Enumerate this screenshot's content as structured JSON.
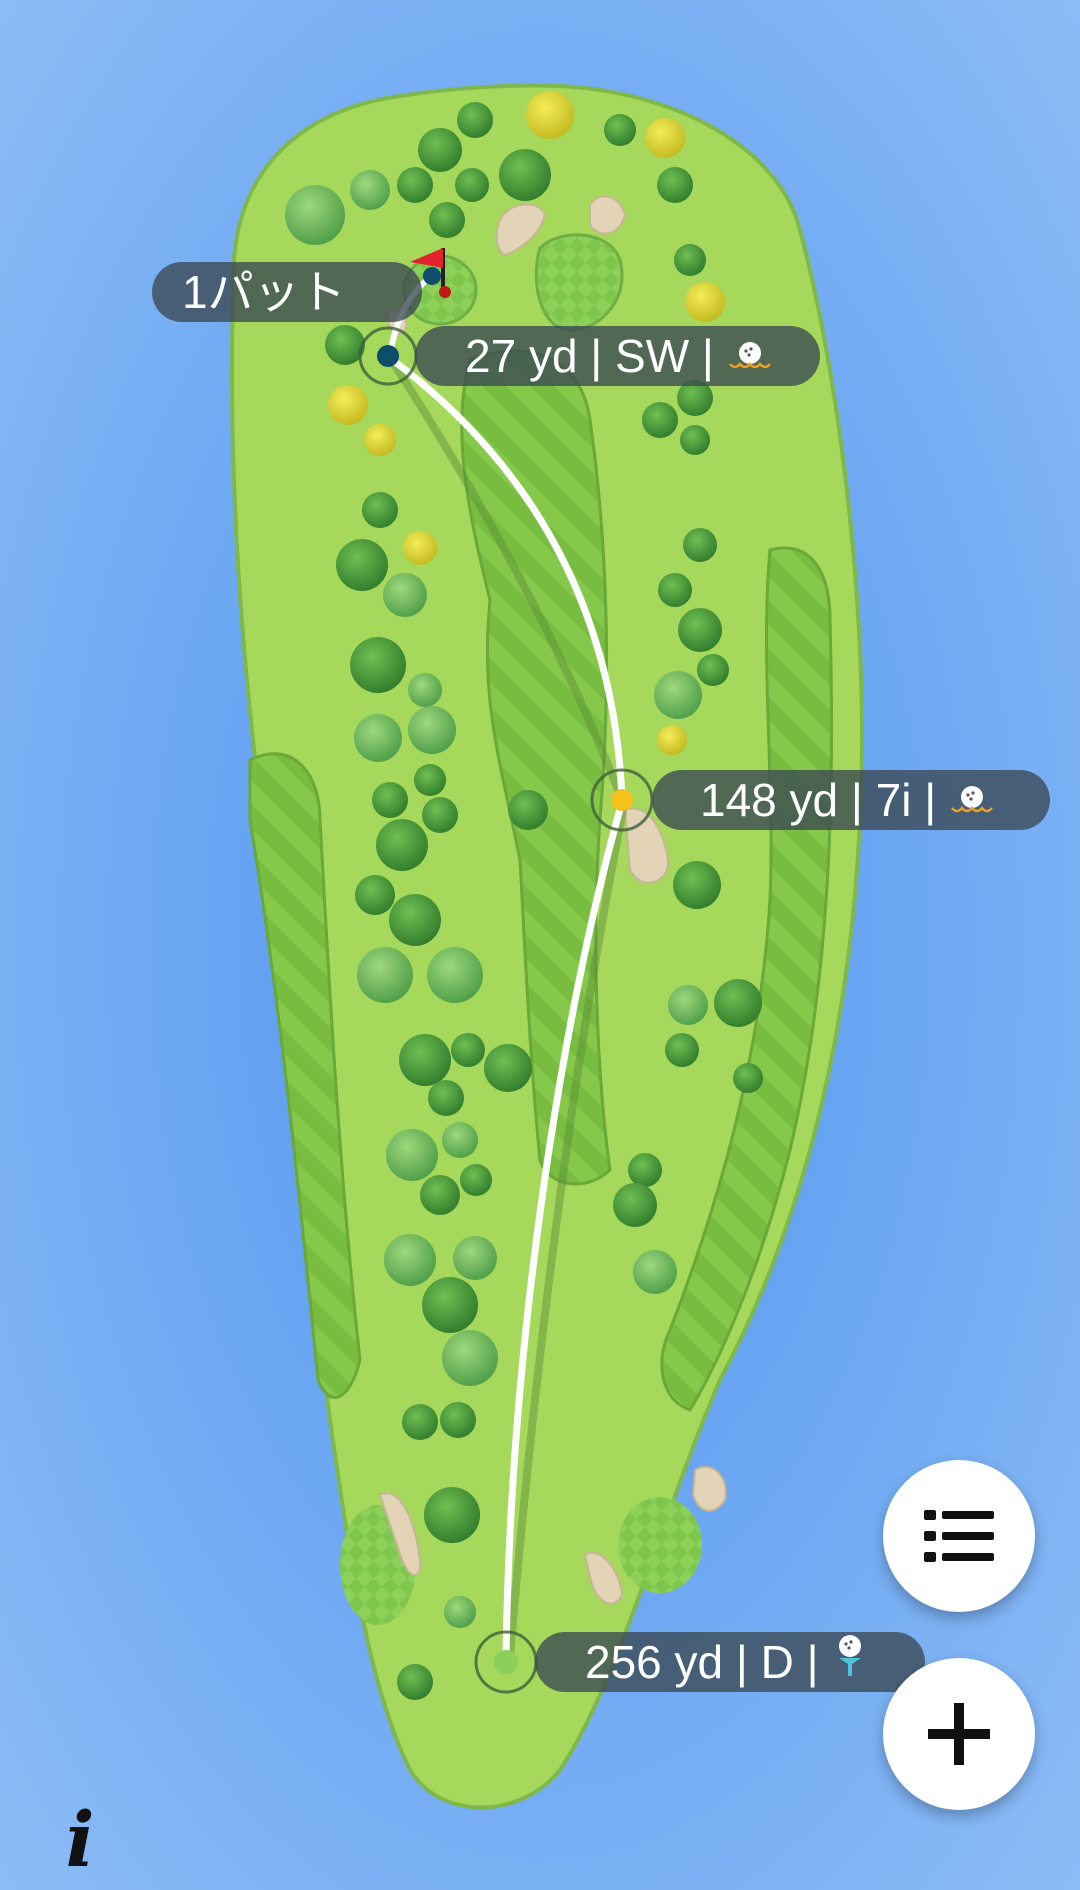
{
  "map": {
    "water_color": "#5c9cee",
    "rough_color": "#a4d85a",
    "fairway_color": "#88c64a",
    "shot_line_color": "#ffffff"
  },
  "shots": [
    {
      "distance": "256 yd",
      "club": "D",
      "separator": "|",
      "icon": "tee-icon",
      "dot_color": "#8cd05a"
    },
    {
      "distance": "148 yd",
      "club": "7i",
      "separator": "|",
      "icon": "ball-on-fairway-icon",
      "dot_color": "#f5c21b"
    },
    {
      "distance": "27 yd",
      "club": "SW",
      "separator": "|",
      "icon": "ball-on-fairway-icon",
      "dot_color": "#0e4d6b"
    }
  ],
  "labels": {
    "tee_shot": "256 yd | D |",
    "second_shot": "148 yd | 7i |",
    "third_shot": "27 yd | SW |",
    "putts": "1パット"
  },
  "flag_color": "#e3232a",
  "buttons": {
    "list_icon": "list-icon",
    "add_icon": "plus-icon",
    "info_label": "i"
  }
}
